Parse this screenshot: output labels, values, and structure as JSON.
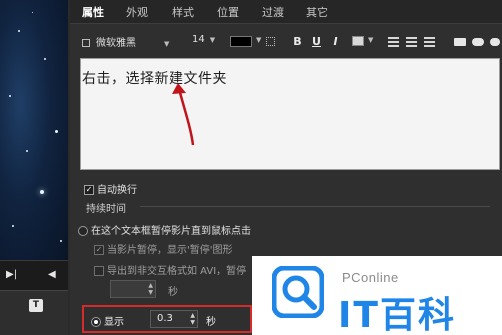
{
  "tabs": [
    {
      "label": "属性",
      "active": true
    },
    {
      "label": "外观",
      "active": false
    },
    {
      "label": "样式",
      "active": false
    },
    {
      "label": "位置",
      "active": false
    },
    {
      "label": "过渡",
      "active": false
    },
    {
      "label": "其它",
      "active": false
    }
  ],
  "toolbar": {
    "font_name": "微软雅黑",
    "font_size": "14",
    "text_color": "#000000",
    "bold_label": "B",
    "underline_label": "U",
    "italic_label": "I"
  },
  "editor": {
    "text": "右击，选择新建文件夹",
    "annotation_color": "#c0141a"
  },
  "options": {
    "auto_wrap": "自动换行",
    "auto_wrap_checked": true,
    "duration_title": "持续时间",
    "pause_until_click": "在这个文本框暂停影片直到鼠标点击",
    "when_paused": "当影片暂停，显示'暂停'图形",
    "when_paused_checked": true,
    "export_avi": "导出到非交互格式如 AVI，暂停",
    "export_avi_checked": false,
    "export_unit": "秒",
    "show_label": "显示",
    "show_value": "0.3",
    "show_unit": "秒"
  },
  "watermark": {
    "brand_small": "PConline",
    "brand_large": "IT百科",
    "brand_color": "#1f86e8"
  },
  "left_toolbar": {
    "t_icon": "T"
  }
}
